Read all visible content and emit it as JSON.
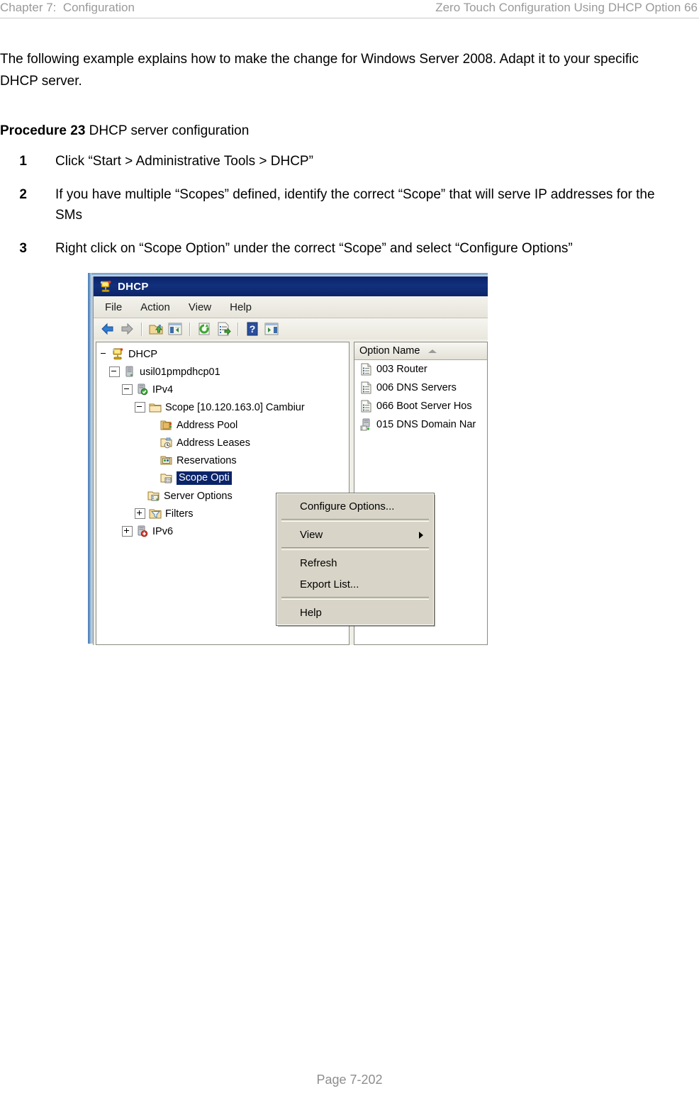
{
  "header": {
    "left": "Chapter 7:  Configuration",
    "right": "Zero Touch Configuration Using DHCP Option 66"
  },
  "intro": "The following example explains how to make the change for Windows Server 2008. Adapt it to your specific DHCP server.",
  "procedure": {
    "label": "Procedure 23",
    "title": " DHCP server configuration"
  },
  "steps": [
    {
      "num": "1",
      "text": "Click “Start > Administrative Tools > DHCP”"
    },
    {
      "num": "2",
      "text": "If you have multiple “Scopes” defined, identify the correct “Scope” that will serve IP addresses for the SMs"
    },
    {
      "num": "3",
      "text": "Right click on “Scope Option” under the correct “Scope” and select “Configure Options”"
    }
  ],
  "dhcp_window": {
    "title": "DHCP",
    "menu": [
      "File",
      "Action",
      "View",
      "Help"
    ],
    "toolbar_icons": [
      "back-arrow-icon",
      "forward-arrow-icon",
      "up-folder-icon",
      "show-tree-icon",
      "refresh-icon",
      "export-list-icon",
      "help-icon",
      "properties-pane-icon"
    ],
    "tree": [
      {
        "label": "DHCP",
        "icon": "dhcp-console-icon",
        "indent": 0,
        "expander": "none",
        "selected": false
      },
      {
        "label": "usil01pmpdhcp01",
        "icon": "server-icon",
        "indent": 1,
        "expander": "minus",
        "selected": false
      },
      {
        "label": "IPv4",
        "icon": "ipv4-server-ok-icon",
        "indent": 2,
        "expander": "minus",
        "selected": false
      },
      {
        "label": "Scope [10.120.163.0] Cambiur",
        "icon": "folder-icon",
        "indent": 3,
        "expander": "minus",
        "selected": false
      },
      {
        "label": "Address Pool",
        "icon": "address-pool-icon",
        "indent": 4,
        "expander": "none",
        "selected": false
      },
      {
        "label": "Address Leases",
        "icon": "address-leases-icon",
        "indent": 4,
        "expander": "none",
        "selected": false
      },
      {
        "label": "Reservations",
        "icon": "reservations-icon",
        "indent": 4,
        "expander": "none",
        "selected": false
      },
      {
        "label": "Scope Opti",
        "icon": "scope-options-icon",
        "indent": 4,
        "expander": "none",
        "selected": true
      },
      {
        "label": "Server Options",
        "icon": "server-options-icon",
        "indent": 3,
        "expander": "none",
        "selected": false
      },
      {
        "label": "Filters",
        "icon": "filters-icon",
        "indent": 3,
        "expander": "plus",
        "selected": false
      },
      {
        "label": "IPv6",
        "icon": "ipv6-server-icon",
        "indent": 2,
        "expander": "plus",
        "selected": false
      }
    ],
    "list": {
      "column_header": "Option Name",
      "sort": "ascending",
      "rows": [
        {
          "label": "003 Router",
          "icon": "option-list-icon"
        },
        {
          "label": "006 DNS Servers",
          "icon": "option-list-icon"
        },
        {
          "label": "066 Boot Server Hos",
          "icon": "option-list-icon"
        },
        {
          "label": "015 DNS Domain Nar",
          "icon": "option-server-icon"
        }
      ]
    },
    "context_menu": [
      {
        "type": "item",
        "label": "Configure Options...",
        "submenu": false
      },
      {
        "type": "separator"
      },
      {
        "type": "item",
        "label": "View",
        "submenu": true
      },
      {
        "type": "separator"
      },
      {
        "type": "item",
        "label": "Refresh",
        "submenu": false
      },
      {
        "type": "item",
        "label": "Export List...",
        "submenu": false
      },
      {
        "type": "separator"
      },
      {
        "type": "item",
        "label": "Help",
        "submenu": false
      }
    ]
  },
  "footer": "Page 7-202",
  "colors": {
    "header_text": "#9a9a9c",
    "titlebar": "#0a246a",
    "selection": "#0a246a",
    "menu_face": "#d8d5c8",
    "frame_blue": "#4a7db5"
  }
}
